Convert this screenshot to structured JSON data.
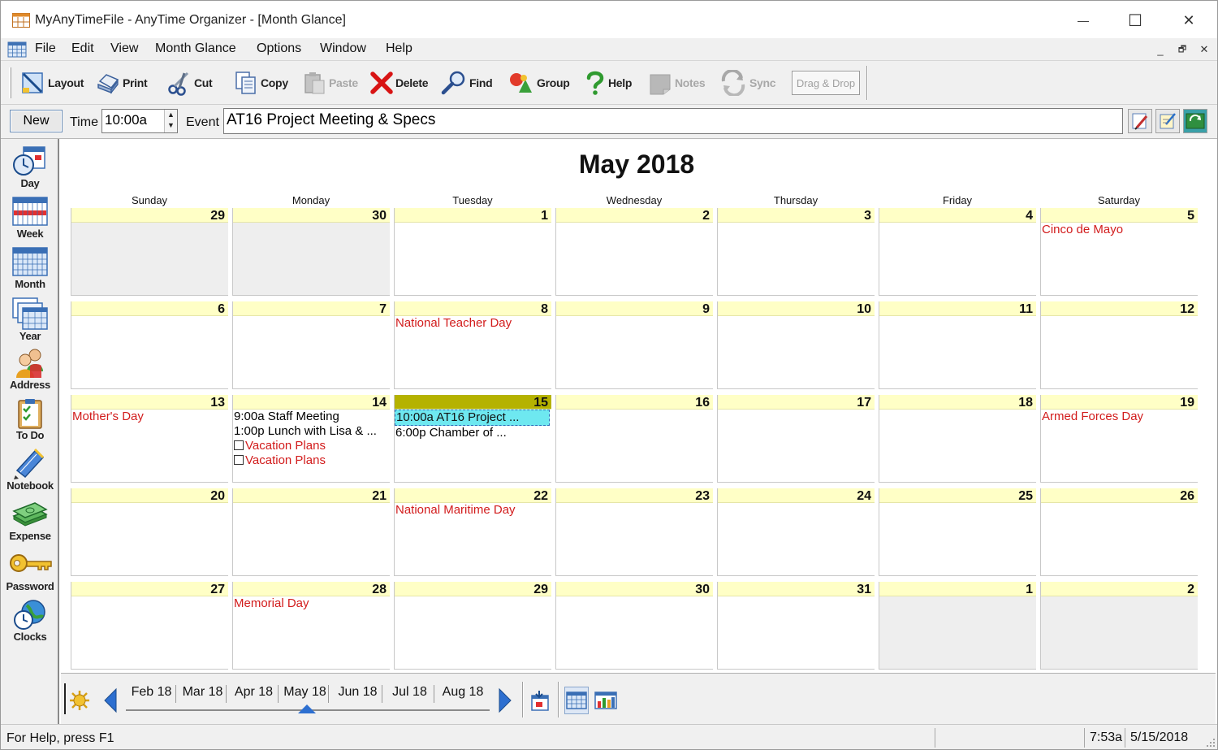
{
  "window": {
    "title": "MyAnyTimeFile - AnyTime Organizer - [Month Glance]",
    "minimize_glyph": "—",
    "maximize_glyph": "☐",
    "close_glyph": "✕"
  },
  "menu": {
    "items": [
      "File",
      "Edit",
      "View",
      "Month Glance",
      "Options",
      "Window",
      "Help"
    ],
    "mdi_min": "_",
    "mdi_restore": "🗗",
    "mdi_close": "✕"
  },
  "toolbar": {
    "layout": "Layout",
    "print": "Print",
    "cut": "Cut",
    "copy": "Copy",
    "paste": "Paste",
    "delete": "Delete",
    "find": "Find",
    "group": "Group",
    "help": "Help",
    "notes": "Notes",
    "sync": "Sync",
    "drag_drop": "Drag & Drop"
  },
  "entry": {
    "new_label": "New",
    "time_label": "Time",
    "time_value": "10:00a",
    "event_label": "Event",
    "event_value": "AT16 Project Meeting & Specs"
  },
  "sidebar": {
    "items": [
      "Day",
      "Week",
      "Month",
      "Year",
      "Address",
      "To Do",
      "Notebook",
      "Expense",
      "Password",
      "Clocks"
    ]
  },
  "calendar": {
    "title": "May 2018",
    "weekdays": [
      "Sunday",
      "Monday",
      "Tuesday",
      "Wednesday",
      "Thursday",
      "Friday",
      "Saturday"
    ],
    "weeks": [
      [
        {
          "day": "29",
          "other": true,
          "events": []
        },
        {
          "day": "30",
          "other": true,
          "events": []
        },
        {
          "day": "1",
          "events": []
        },
        {
          "day": "2",
          "events": []
        },
        {
          "day": "3",
          "events": []
        },
        {
          "day": "4",
          "events": []
        },
        {
          "day": "5",
          "events": [
            {
              "text": "Cinco de Mayo",
              "kind": "holiday"
            }
          ]
        }
      ],
      [
        {
          "day": "6",
          "events": []
        },
        {
          "day": "7",
          "events": []
        },
        {
          "day": "8",
          "events": [
            {
              "text": "National Teacher Day",
              "kind": "holiday"
            }
          ]
        },
        {
          "day": "9",
          "events": []
        },
        {
          "day": "10",
          "events": []
        },
        {
          "day": "11",
          "events": []
        },
        {
          "day": "12",
          "events": []
        }
      ],
      [
        {
          "day": "13",
          "events": [
            {
              "text": "Mother's Day",
              "kind": "holiday"
            }
          ]
        },
        {
          "day": "14",
          "events": [
            {
              "text": "9:00a Staff Meeting",
              "kind": "appt"
            },
            {
              "text": "1:00p Lunch with Lisa & ...",
              "kind": "appt"
            },
            {
              "text": "Vacation Plans",
              "kind": "todo"
            },
            {
              "text": "Vacation Plans",
              "kind": "todo"
            }
          ]
        },
        {
          "day": "15",
          "today": true,
          "events": [
            {
              "text": "10:00a AT16 Project ...",
              "kind": "selected"
            },
            {
              "text": "6:00p Chamber of ...",
              "kind": "appt"
            }
          ]
        },
        {
          "day": "16",
          "events": []
        },
        {
          "day": "17",
          "events": []
        },
        {
          "day": "18",
          "events": []
        },
        {
          "day": "19",
          "events": [
            {
              "text": "Armed Forces Day",
              "kind": "holiday"
            }
          ]
        }
      ],
      [
        {
          "day": "20",
          "events": []
        },
        {
          "day": "21",
          "events": []
        },
        {
          "day": "22",
          "events": [
            {
              "text": "National Maritime Day",
              "kind": "holiday"
            }
          ]
        },
        {
          "day": "23",
          "events": []
        },
        {
          "day": "24",
          "events": []
        },
        {
          "day": "25",
          "events": []
        },
        {
          "day": "26",
          "events": []
        }
      ],
      [
        {
          "day": "27",
          "events": []
        },
        {
          "day": "28",
          "events": [
            {
              "text": "Memorial Day",
              "kind": "holiday"
            }
          ]
        },
        {
          "day": "29",
          "events": []
        },
        {
          "day": "30",
          "events": []
        },
        {
          "day": "31",
          "events": []
        },
        {
          "day": "1",
          "other": true,
          "events": []
        },
        {
          "day": "2",
          "other": true,
          "events": []
        }
      ]
    ]
  },
  "month_nav": {
    "months": [
      "Feb 18",
      "Mar 18",
      "Apr 18",
      "May 18",
      "Jun 18",
      "Jul 18",
      "Aug 18"
    ],
    "current": "May 18"
  },
  "status": {
    "help_text": "For Help, press F1",
    "time": "7:53a",
    "date": "5/15/2018"
  },
  "colors": {
    "day_header": "#ffffc6",
    "today_header": "#b5b200",
    "holiday_text": "#d21c1c",
    "selected_event": "#6ee8f0",
    "other_month": "#eeeeee"
  }
}
